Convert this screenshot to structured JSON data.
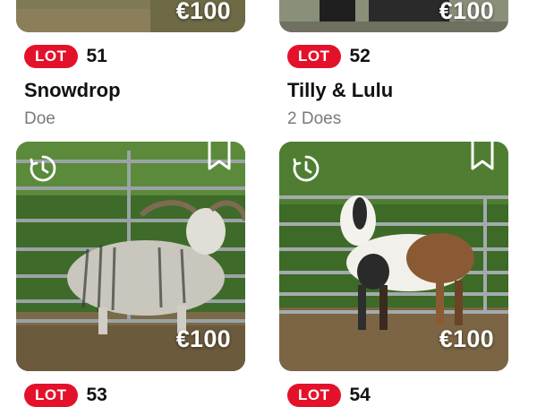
{
  "lots": [
    {
      "badge": "LOT",
      "number": "51",
      "title": "Snowdrop",
      "subtitle": "Doe",
      "price": "€100"
    },
    {
      "badge": "LOT",
      "number": "52",
      "title": "Tilly & Lulu",
      "subtitle": "2 Does",
      "price": "€100"
    },
    {
      "badge": "LOT",
      "number": "53",
      "price": "€100"
    },
    {
      "badge": "LOT",
      "number": "54",
      "price": "€100"
    }
  ],
  "colors": {
    "badge": "#e4112a",
    "title": "#111111",
    "subtitle": "#7a7a7a",
    "price": "#ffffff"
  },
  "icons": {
    "timer": "timer-clock-icon",
    "save": "bookmark-icon"
  }
}
